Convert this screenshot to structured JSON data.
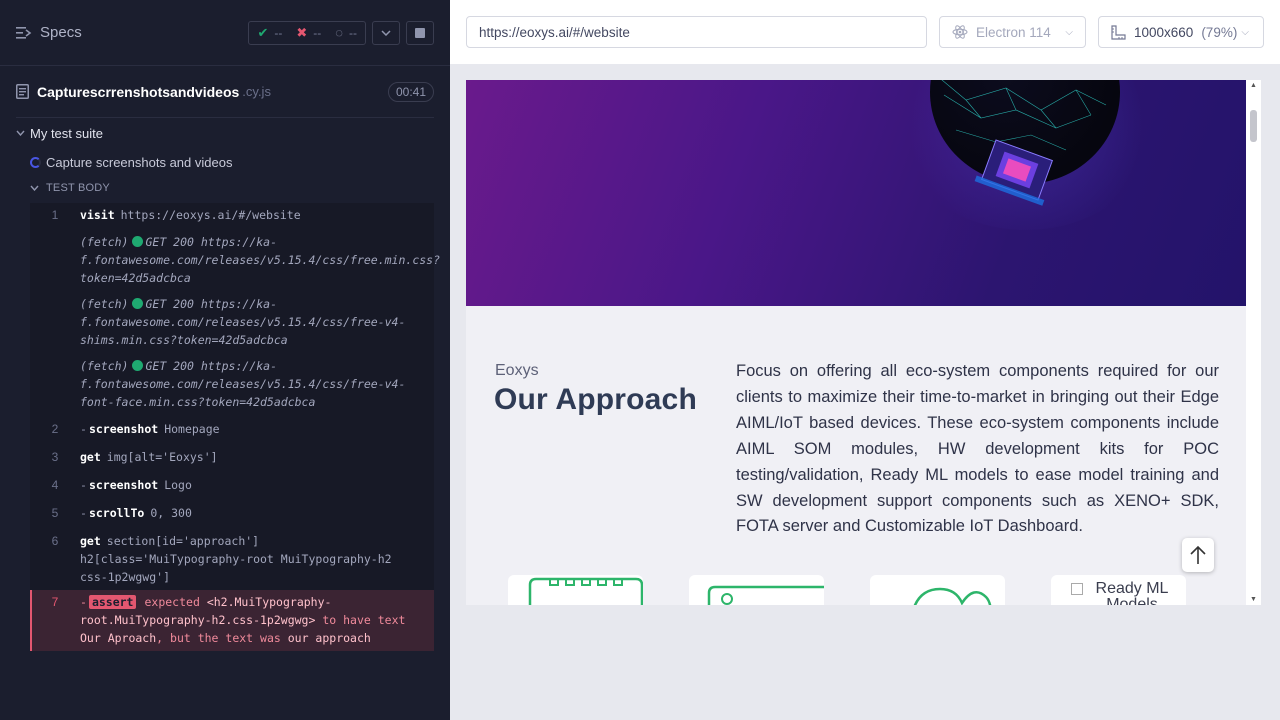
{
  "reporter": {
    "specs_label": "Specs",
    "stats": {
      "passed": "--",
      "failed": "--",
      "pending": "--"
    },
    "spec": {
      "name": "Capturescrrenshotsandvideos",
      "ext": ".cy.js",
      "duration": "00:41"
    },
    "suite_title": "My test suite",
    "test_title": "Capture screenshots and videos",
    "test_body_label": "TEST BODY",
    "commands": [
      {
        "num": "1",
        "name": "visit",
        "message": "https://eoxys.ai/#/website"
      },
      {
        "fetch_label": "(fetch)",
        "text": "GET 200 https://ka-f.fontawesome.com/releases/v5.15.4/css/free.min.css?token=42d5adcbca"
      },
      {
        "fetch_label": "(fetch)",
        "text": "GET 200 https://ka-f.fontawesome.com/releases/v5.15.4/css/free-v4-shims.min.css?token=42d5adcbca"
      },
      {
        "fetch_label": "(fetch)",
        "text": "GET 200 https://ka-f.fontawesome.com/releases/v5.15.4/css/free-v4-font-face.min.css?token=42d5adcbca"
      },
      {
        "num": "2",
        "prefix": "-",
        "name": "screenshot",
        "message": "Homepage"
      },
      {
        "num": "3",
        "name": "get",
        "message": "img[alt='Eoxys']"
      },
      {
        "num": "4",
        "prefix": "-",
        "name": "screenshot",
        "message": "Logo"
      },
      {
        "num": "5",
        "prefix": "-",
        "name": "scrollTo",
        "message": "0, 300"
      },
      {
        "num": "6",
        "name": "get",
        "message": "section[id='approach'] h2[class='MuiTypography-root MuiTypography-h2 css-1p2wgwg']"
      },
      {
        "num": "7",
        "prefix": "-",
        "name": "assert",
        "expected_label": "expected",
        "subject": "<h2.MuiTypography-root.MuiTypography-h2.css-1p2wgwg>",
        "to_have": "to have text",
        "expected_text": "Our Aproach",
        "but_label": ", but the text was",
        "actual_text": "our approach"
      }
    ]
  },
  "aut": {
    "url": "https://eoxys.ai/#/website",
    "browser": "Electron 114",
    "viewport": "1000x660",
    "scale": "(79%)"
  },
  "site": {
    "eyebrow": "Eoxys",
    "heading": "Our Approach",
    "paragraph": "Focus on offering all eco-system components required for our clients to maximize their time-to-market in bringing out their Edge AIML/IoT based devices. These eco-system components include AIML SOM modules, HW development kits for POC testing/validation, Ready ML models to ease model training and SW development support components such as XENO+ SDK, FOTA server and Customizable IoT Dashboard.",
    "card4_alt": "Ready ML Models"
  },
  "colors": {
    "pass": "#1fa971",
    "fail": "#e45770",
    "accent": "#4956e3"
  }
}
